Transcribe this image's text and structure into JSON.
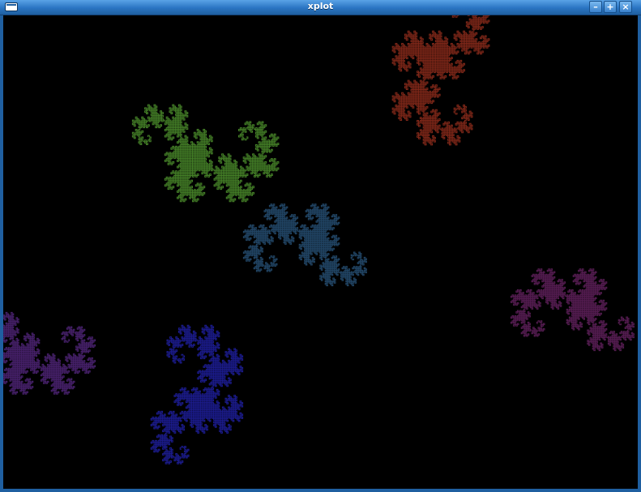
{
  "window": {
    "title": "xplot",
    "buttons": {
      "minimize_icon": "minimize-icon",
      "maximize_icon": "maximize-icon",
      "close_icon": "close-icon"
    }
  },
  "plot": {
    "background": "#000000",
    "curve": "dragon-fractal-copies",
    "colors": {
      "green": "#4a8a2a",
      "red": "#8a2a1a",
      "blue": "#1e1e9a",
      "purple": "#4a2270",
      "teal": "#23496a",
      "magenta": "#5a1e55"
    }
  }
}
